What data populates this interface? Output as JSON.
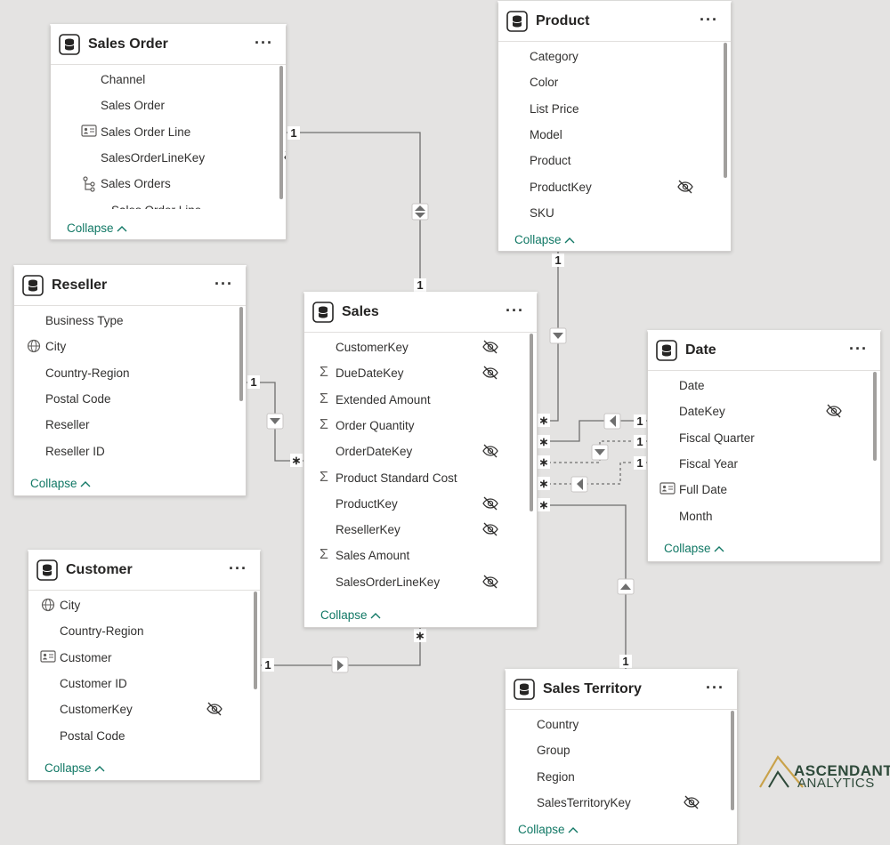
{
  "tables": [
    {
      "id": "sales-order",
      "title": "Sales Order",
      "collapse_label": "Collapse",
      "fields": [
        {
          "name": "Channel",
          "icon": "none",
          "hidden": false
        },
        {
          "name": "Sales Order",
          "icon": "none",
          "hidden": false
        },
        {
          "name": "Sales Order Line",
          "icon": "id-card",
          "hidden": false
        },
        {
          "name": "SalesOrderLineKey",
          "icon": "none",
          "hidden": true
        },
        {
          "name": "Sales Orders",
          "icon": "hierarchy",
          "hidden": false
        },
        {
          "name": "Sales Order Line",
          "icon": "none",
          "hidden": false,
          "indent": true
        }
      ]
    },
    {
      "id": "product",
      "title": "Product",
      "collapse_label": "Collapse",
      "fields": [
        {
          "name": "Category",
          "icon": "none",
          "hidden": false
        },
        {
          "name": "Color",
          "icon": "none",
          "hidden": false
        },
        {
          "name": "List Price",
          "icon": "none",
          "hidden": false
        },
        {
          "name": "Model",
          "icon": "none",
          "hidden": false
        },
        {
          "name": "Product",
          "icon": "none",
          "hidden": false
        },
        {
          "name": "ProductKey",
          "icon": "none",
          "hidden": true
        },
        {
          "name": "SKU",
          "icon": "none",
          "hidden": false
        }
      ]
    },
    {
      "id": "reseller",
      "title": "Reseller",
      "collapse_label": "Collapse",
      "fields": [
        {
          "name": "Business Type",
          "icon": "none",
          "hidden": false
        },
        {
          "name": "City",
          "icon": "globe",
          "hidden": false
        },
        {
          "name": "Country-Region",
          "icon": "none",
          "hidden": false
        },
        {
          "name": "Postal Code",
          "icon": "none",
          "hidden": false
        },
        {
          "name": "Reseller",
          "icon": "none",
          "hidden": false
        },
        {
          "name": "Reseller ID",
          "icon": "none",
          "hidden": false
        }
      ]
    },
    {
      "id": "sales",
      "title": "Sales",
      "collapse_label": "Collapse",
      "fields": [
        {
          "name": "CustomerKey",
          "icon": "none",
          "hidden": true
        },
        {
          "name": "DueDateKey",
          "icon": "sigma",
          "hidden": true
        },
        {
          "name": "Extended Amount",
          "icon": "sigma",
          "hidden": false
        },
        {
          "name": "Order Quantity",
          "icon": "sigma",
          "hidden": false
        },
        {
          "name": "OrderDateKey",
          "icon": "none",
          "hidden": true
        },
        {
          "name": "Product Standard Cost",
          "icon": "sigma",
          "hidden": false
        },
        {
          "name": "ProductKey",
          "icon": "none",
          "hidden": true
        },
        {
          "name": "ResellerKey",
          "icon": "none",
          "hidden": true
        },
        {
          "name": "Sales Amount",
          "icon": "sigma",
          "hidden": false
        },
        {
          "name": "SalesOrderLineKey",
          "icon": "none",
          "hidden": true
        }
      ]
    },
    {
      "id": "date",
      "title": "Date",
      "collapse_label": "Collapse",
      "fields": [
        {
          "name": "Date",
          "icon": "none",
          "hidden": false
        },
        {
          "name": "DateKey",
          "icon": "none",
          "hidden": true
        },
        {
          "name": "Fiscal Quarter",
          "icon": "none",
          "hidden": false
        },
        {
          "name": "Fiscal Year",
          "icon": "none",
          "hidden": false
        },
        {
          "name": "Full Date",
          "icon": "id-card",
          "hidden": false
        },
        {
          "name": "Month",
          "icon": "none",
          "hidden": false
        }
      ]
    },
    {
      "id": "customer",
      "title": "Customer",
      "collapse_label": "Collapse",
      "fields": [
        {
          "name": "City",
          "icon": "globe",
          "hidden": false
        },
        {
          "name": "Country-Region",
          "icon": "none",
          "hidden": false
        },
        {
          "name": "Customer",
          "icon": "id-card",
          "hidden": false
        },
        {
          "name": "Customer ID",
          "icon": "none",
          "hidden": false
        },
        {
          "name": "CustomerKey",
          "icon": "none",
          "hidden": true
        },
        {
          "name": "Postal Code",
          "icon": "none",
          "hidden": false
        }
      ]
    },
    {
      "id": "sales-territory",
      "title": "Sales Territory",
      "collapse_label": "Collapse",
      "fields": [
        {
          "name": "Country",
          "icon": "none",
          "hidden": false
        },
        {
          "name": "Group",
          "icon": "none",
          "hidden": false
        },
        {
          "name": "Region",
          "icon": "none",
          "hidden": false
        },
        {
          "name": "SalesTerritoryKey",
          "icon": "none",
          "hidden": true
        }
      ]
    }
  ],
  "relationships": [
    {
      "from": "Sales Order",
      "to": "Sales",
      "from_cardinality": "1",
      "to_cardinality": "1",
      "filter": "both",
      "active": true
    },
    {
      "from": "Product",
      "to": "Sales",
      "from_cardinality": "1",
      "to_cardinality": "*",
      "filter": "single",
      "active": true
    },
    {
      "from": "Reseller",
      "to": "Sales",
      "from_cardinality": "1",
      "to_cardinality": "*",
      "filter": "single",
      "active": true
    },
    {
      "from": "Date",
      "to": "Sales",
      "from_cardinality": "1",
      "to_cardinality": "*",
      "filter": "single",
      "active": true
    },
    {
      "from": "Date",
      "to": "Sales",
      "from_cardinality": "1",
      "to_cardinality": "*",
      "filter": "single",
      "active": false
    },
    {
      "from": "Date",
      "to": "Sales",
      "from_cardinality": "1",
      "to_cardinality": "*",
      "filter": "single",
      "active": false
    },
    {
      "from": "Sales Territory",
      "to": "Sales",
      "from_cardinality": "1",
      "to_cardinality": "*",
      "filter": "single",
      "active": true
    },
    {
      "from": "Customer",
      "to": "Sales",
      "from_cardinality": "1",
      "to_cardinality": "*",
      "filter": "single",
      "active": true
    }
  ],
  "logo": {
    "line1": "ASCENDANT",
    "line2": "ANALYTICS",
    "color": "#2e4a3a",
    "accent": "#c9a24a"
  },
  "colors": {
    "canvas": "#e4e3e2",
    "collapse": "#117865",
    "line": "#6e6e6e"
  }
}
